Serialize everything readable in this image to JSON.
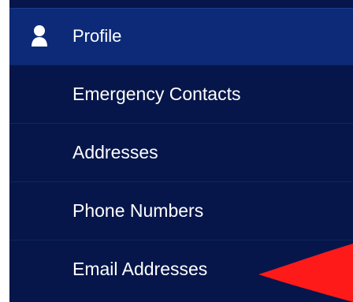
{
  "menu": {
    "profile": {
      "label": "Profile",
      "icon": "user-icon"
    },
    "items": [
      {
        "label": "Emergency Contacts"
      },
      {
        "label": "Addresses"
      },
      {
        "label": "Phone Numbers"
      },
      {
        "label": "Email Addresses"
      }
    ]
  },
  "colors": {
    "menu_background": "#06164a",
    "active_header": "#0c2a78",
    "text": "#ffffff",
    "annotation_arrow": "#ff1a1a"
  }
}
